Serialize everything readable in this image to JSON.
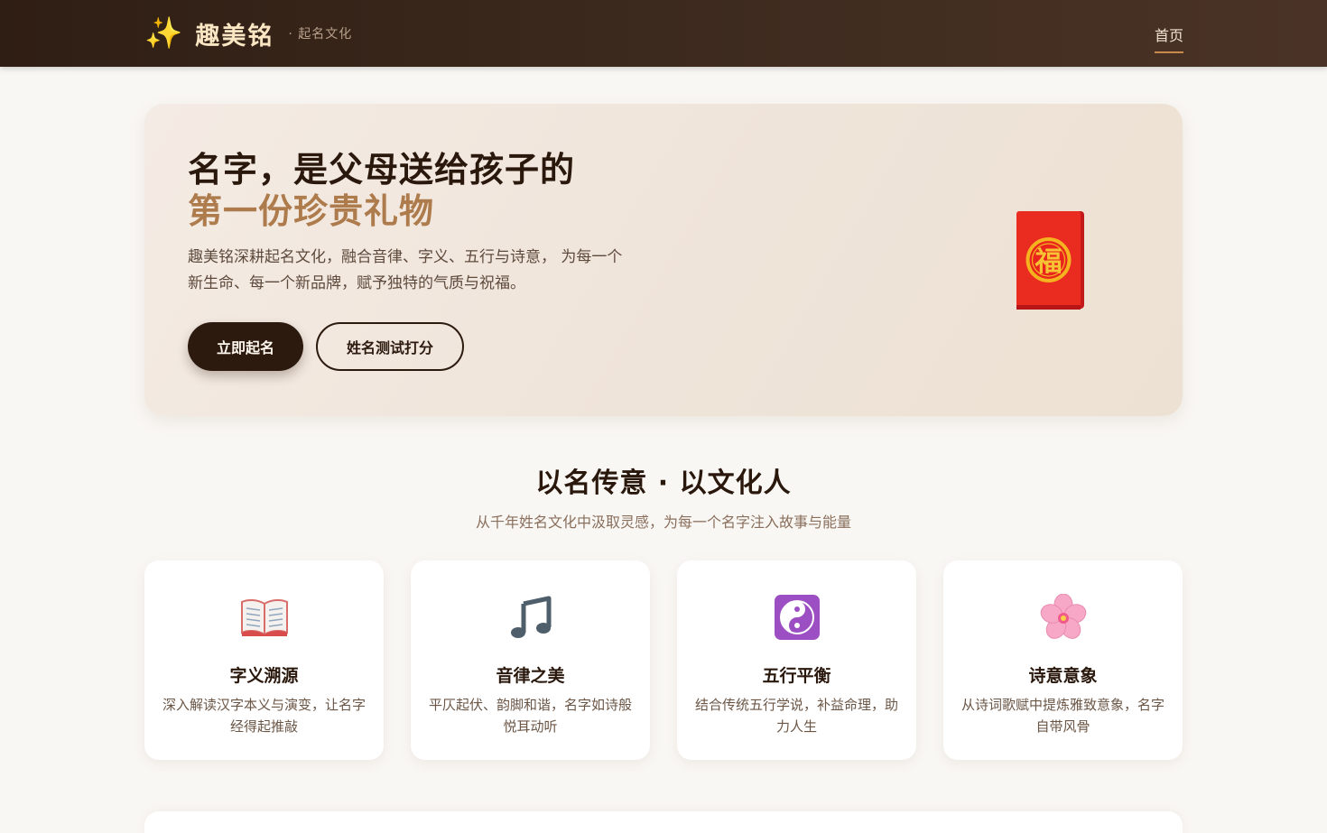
{
  "header": {
    "brand_icon": "sparkles-icon",
    "brand_name": "趣美铭",
    "brand_sub": "· 起名文化",
    "nav_home": "首页"
  },
  "hero": {
    "title_line1": "名字，是父母送给孩子的",
    "title_line2": "第一份珍贵礼物",
    "description": "趣美铭深耕起名文化，融合音律、字义、五行与诗意， 为每一个新生命、每一个新品牌，赋予独特的气质与祝福。",
    "primary_button": "立即起名",
    "secondary_button": "姓名测试打分",
    "envelope_glyph": "福",
    "envelope_icon": "red-envelope-icon"
  },
  "section": {
    "title": "以名传意 · 以文化人",
    "subtitle": "从千年姓名文化中汲取灵感，为每一个名字注入故事与能量"
  },
  "features": [
    {
      "icon": "open-book-icon",
      "title": "字义溯源",
      "desc": "深入解读汉字本义与演变，让名字经得起推敲"
    },
    {
      "icon": "music-note-icon",
      "title": "音律之美",
      "desc": "平仄起伏、韵脚和谐，名字如诗般悦耳动听"
    },
    {
      "icon": "yin-yang-icon",
      "title": "五行平衡",
      "desc": "结合传统五行学说，补益命理，助力人生"
    },
    {
      "icon": "cherry-blossom-icon",
      "title": "诗意意象",
      "desc": "从诗词歌赋中提炼雅致意象，名字自带风骨"
    }
  ],
  "colors": {
    "header_bg": "#3d2a1e",
    "accent_gold": "#ad7b4c",
    "primary_dark": "#2d1a0f",
    "envelope_red": "#e8241c"
  }
}
